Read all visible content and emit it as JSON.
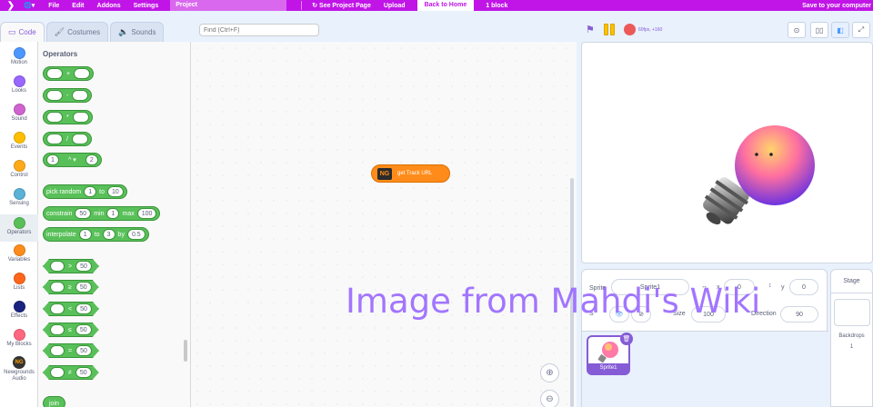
{
  "menu": {
    "file": "File",
    "edit": "Edit",
    "addons": "Addons",
    "settings": "Settings",
    "project_title": "Project",
    "see_project_page": "See Project Page",
    "upload": "Upload",
    "back_to_home": "Back to Home",
    "block_count": "1 block",
    "save": "Save to your computer"
  },
  "tabs": {
    "code": "Code",
    "costumes": "Costumes",
    "sounds": "Sounds"
  },
  "search": {
    "placeholder": "Find (Ctrl+F)"
  },
  "categories": [
    {
      "label": "Motion",
      "color": "#4c97ff"
    },
    {
      "label": "Looks",
      "color": "#9966ff"
    },
    {
      "label": "Sound",
      "color": "#cf63cf"
    },
    {
      "label": "Events",
      "color": "#ffbf00"
    },
    {
      "label": "Control",
      "color": "#ffab19"
    },
    {
      "label": "Sensing",
      "color": "#5cb1d6"
    },
    {
      "label": "Operators",
      "color": "#59c059"
    },
    {
      "label": "Variables",
      "color": "#ff8c1a"
    },
    {
      "label": "Lists",
      "color": "#ff661a"
    },
    {
      "label": "Effects",
      "color": "#1a237e"
    },
    {
      "label": "My Blocks",
      "color": "#ff6680"
    },
    {
      "label": "Newgrounds Audio",
      "color": "#333333"
    }
  ],
  "palette": {
    "title": "Operators",
    "arith_ops": [
      "+",
      "-",
      "*",
      "/"
    ],
    "power": {
      "a": "1",
      "op": "^",
      "b": "2"
    },
    "pick_random": {
      "text": "pick random",
      "a": "1",
      "to": "to",
      "b": "10"
    },
    "constrain": {
      "text": "constrain",
      "a": "50",
      "min": "min",
      "b": "1",
      "max": "max",
      "c": "100"
    },
    "interpolate": {
      "text": "interpolate",
      "a": "1",
      "to": "to",
      "b": "3",
      "by": "by",
      "c": "0.5"
    },
    "compare": [
      {
        "op": ">",
        "value": "50"
      },
      {
        "op": "≥",
        "value": "50"
      },
      {
        "op": "<",
        "value": "50"
      },
      {
        "op": "≤",
        "value": "50"
      },
      {
        "op": "=",
        "value": "50"
      },
      {
        "op": "≠",
        "value": "50"
      }
    ],
    "join_label": "join"
  },
  "workspace": {
    "block_label": "get Track URL",
    "block_icon": "NG"
  },
  "stage_header": {
    "fps": "60fps, +160"
  },
  "sprite_info": {
    "sprite_label": "Sprite",
    "sprite_name": "Sprite1",
    "x_label": "x",
    "x_value": "0",
    "y_label": "y",
    "y_value": "0",
    "size_label": "Size",
    "size_value": "100",
    "direction_label": "Direction",
    "direction_value": "90"
  },
  "sprites": [
    {
      "name": "Sprite1"
    }
  ],
  "stage_pane": {
    "title": "Stage",
    "backdrops_label": "Backdrops",
    "backdrops_count": "1"
  },
  "watermark": "Image from Mahdi's Wiki"
}
